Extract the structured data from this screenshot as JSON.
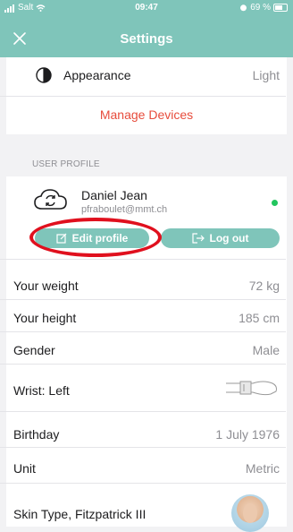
{
  "status": {
    "carrier": "Salt",
    "time": "09:47",
    "battery": "69 %"
  },
  "nav": {
    "title": "Settings"
  },
  "settings": {
    "appearance": {
      "label": "Appearance",
      "value": "Light"
    },
    "manage_devices": "Manage Devices"
  },
  "profile": {
    "section_header": "USER PROFILE",
    "name": "Daniel Jean",
    "email": "pfraboulet@mmt.ch",
    "status_color": "#22c55e",
    "edit_label": "Edit profile",
    "logout_label": "Log out",
    "rows": [
      {
        "label": "Your weight",
        "value": "72 kg"
      },
      {
        "label": "Your height",
        "value": "185 cm"
      },
      {
        "label": "Gender",
        "value": "Male"
      },
      {
        "label": "Wrist: Left",
        "value": ""
      },
      {
        "label": "Birthday",
        "value": "1 July 1976"
      },
      {
        "label": "Unit",
        "value": "Metric"
      },
      {
        "label": "Skin Type, Fitzpatrick III",
        "value": ""
      }
    ]
  },
  "colors": {
    "accent": "#7fc5ba",
    "danger": "#e74c3c",
    "annotation": "#e0101e"
  }
}
